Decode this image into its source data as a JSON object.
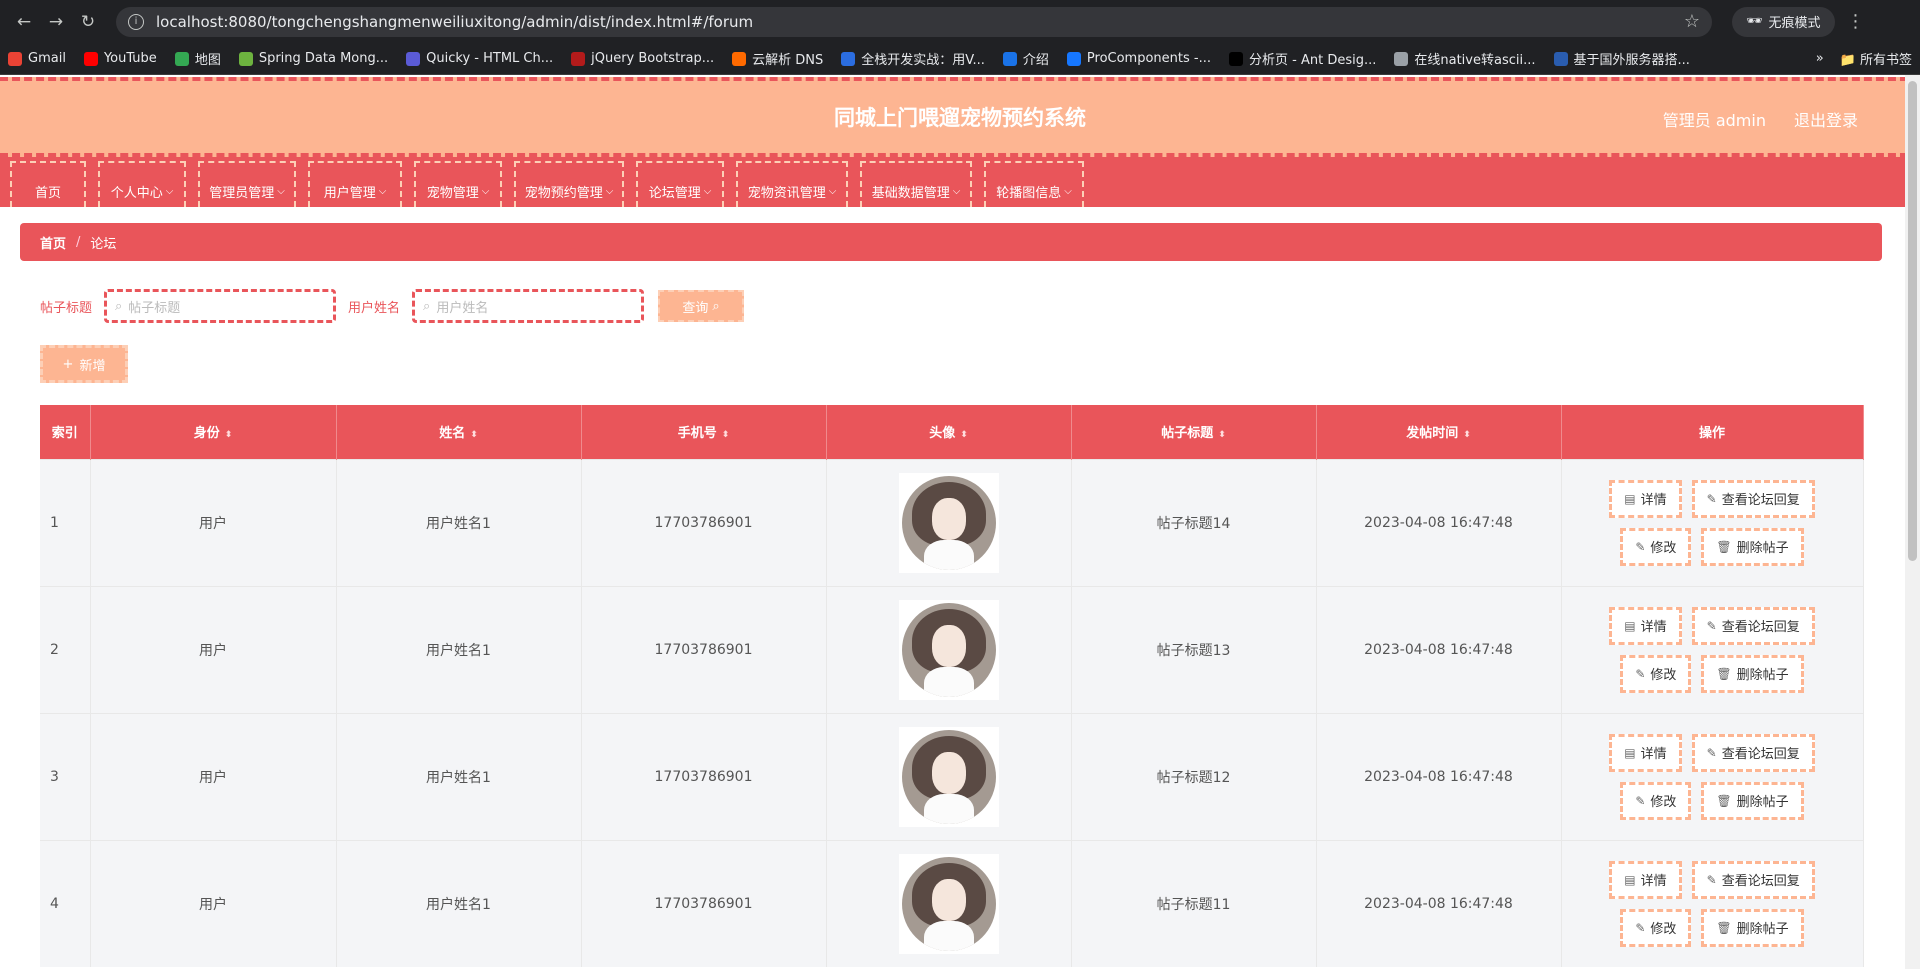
{
  "browser": {
    "url": "localhost:8080/tongchengshangmenweiliuxitong/admin/dist/index.html#/forum",
    "incognito_label": "无痕模式",
    "bookmarks": [
      {
        "label": "Gmail",
        "color": "#ea4335"
      },
      {
        "label": "YouTube",
        "color": "#ff0000"
      },
      {
        "label": "地图",
        "color": "#34a853"
      },
      {
        "label": "Spring Data Mong...",
        "color": "#6db33f"
      },
      {
        "label": "Quicky - HTML Ch...",
        "color": "#5b5bd6"
      },
      {
        "label": "jQuery Bootstrap...",
        "color": "#b31b1b"
      },
      {
        "label": "云解析 DNS",
        "color": "#ff6a00"
      },
      {
        "label": "全栈开发实战：用V...",
        "color": "#2b6de0"
      },
      {
        "label": "介绍",
        "color": "#1a73e8"
      },
      {
        "label": "ProComponents -...",
        "color": "#1677ff"
      },
      {
        "label": "分析页 - Ant Desig...",
        "color": "#000000"
      },
      {
        "label": "在线native转ascii...",
        "color": "#9aa0a6"
      },
      {
        "label": "基于国外服务器搭...",
        "color": "#2a5db0"
      }
    ],
    "all_bookmarks_label": "所有书签"
  },
  "header": {
    "title": "同城上门喂遛宠物预约系统",
    "user_label": "管理员 admin",
    "logout_label": "退出登录"
  },
  "nav": [
    {
      "label": "首页",
      "dropdown": false
    },
    {
      "label": "个人中心",
      "dropdown": true
    },
    {
      "label": "管理员管理",
      "dropdown": true
    },
    {
      "label": "用户管理",
      "dropdown": true
    },
    {
      "label": "宠物管理",
      "dropdown": true
    },
    {
      "label": "宠物预约管理",
      "dropdown": true
    },
    {
      "label": "论坛管理",
      "dropdown": true
    },
    {
      "label": "宠物资讯管理",
      "dropdown": true
    },
    {
      "label": "基础数据管理",
      "dropdown": true
    },
    {
      "label": "轮播图信息",
      "dropdown": true
    }
  ],
  "breadcrumb": {
    "home": "首页",
    "separator": "/",
    "current": "论坛"
  },
  "search": {
    "title_label": "帖子标题",
    "title_placeholder": "帖子标题",
    "name_label": "用户姓名",
    "name_placeholder": "用户姓名",
    "query_label": "查询"
  },
  "add_label": "新增",
  "table": {
    "columns": [
      "索引",
      "身份",
      "姓名",
      "手机号",
      "头像",
      "帖子标题",
      "发帖时间",
      "操作"
    ],
    "rows": [
      {
        "index": "1",
        "role": "用户",
        "name": "用户姓名1",
        "phone": "17703786901",
        "title": "帖子标题14",
        "time": "2023-04-08 16:47:48"
      },
      {
        "index": "2",
        "role": "用户",
        "name": "用户姓名1",
        "phone": "17703786901",
        "title": "帖子标题13",
        "time": "2023-04-08 16:47:48"
      },
      {
        "index": "3",
        "role": "用户",
        "name": "用户姓名1",
        "phone": "17703786901",
        "title": "帖子标题12",
        "time": "2023-04-08 16:47:48"
      },
      {
        "index": "4",
        "role": "用户",
        "name": "用户姓名1",
        "phone": "17703786901",
        "title": "帖子标题11",
        "time": "2023-04-08 16:47:48"
      }
    ],
    "actions": {
      "detail": "详情",
      "replies": "查看论坛回复",
      "edit": "修改",
      "delete": "删除帖子"
    }
  },
  "colors": {
    "primary": "#e9555a",
    "accent": "#fdb592"
  }
}
